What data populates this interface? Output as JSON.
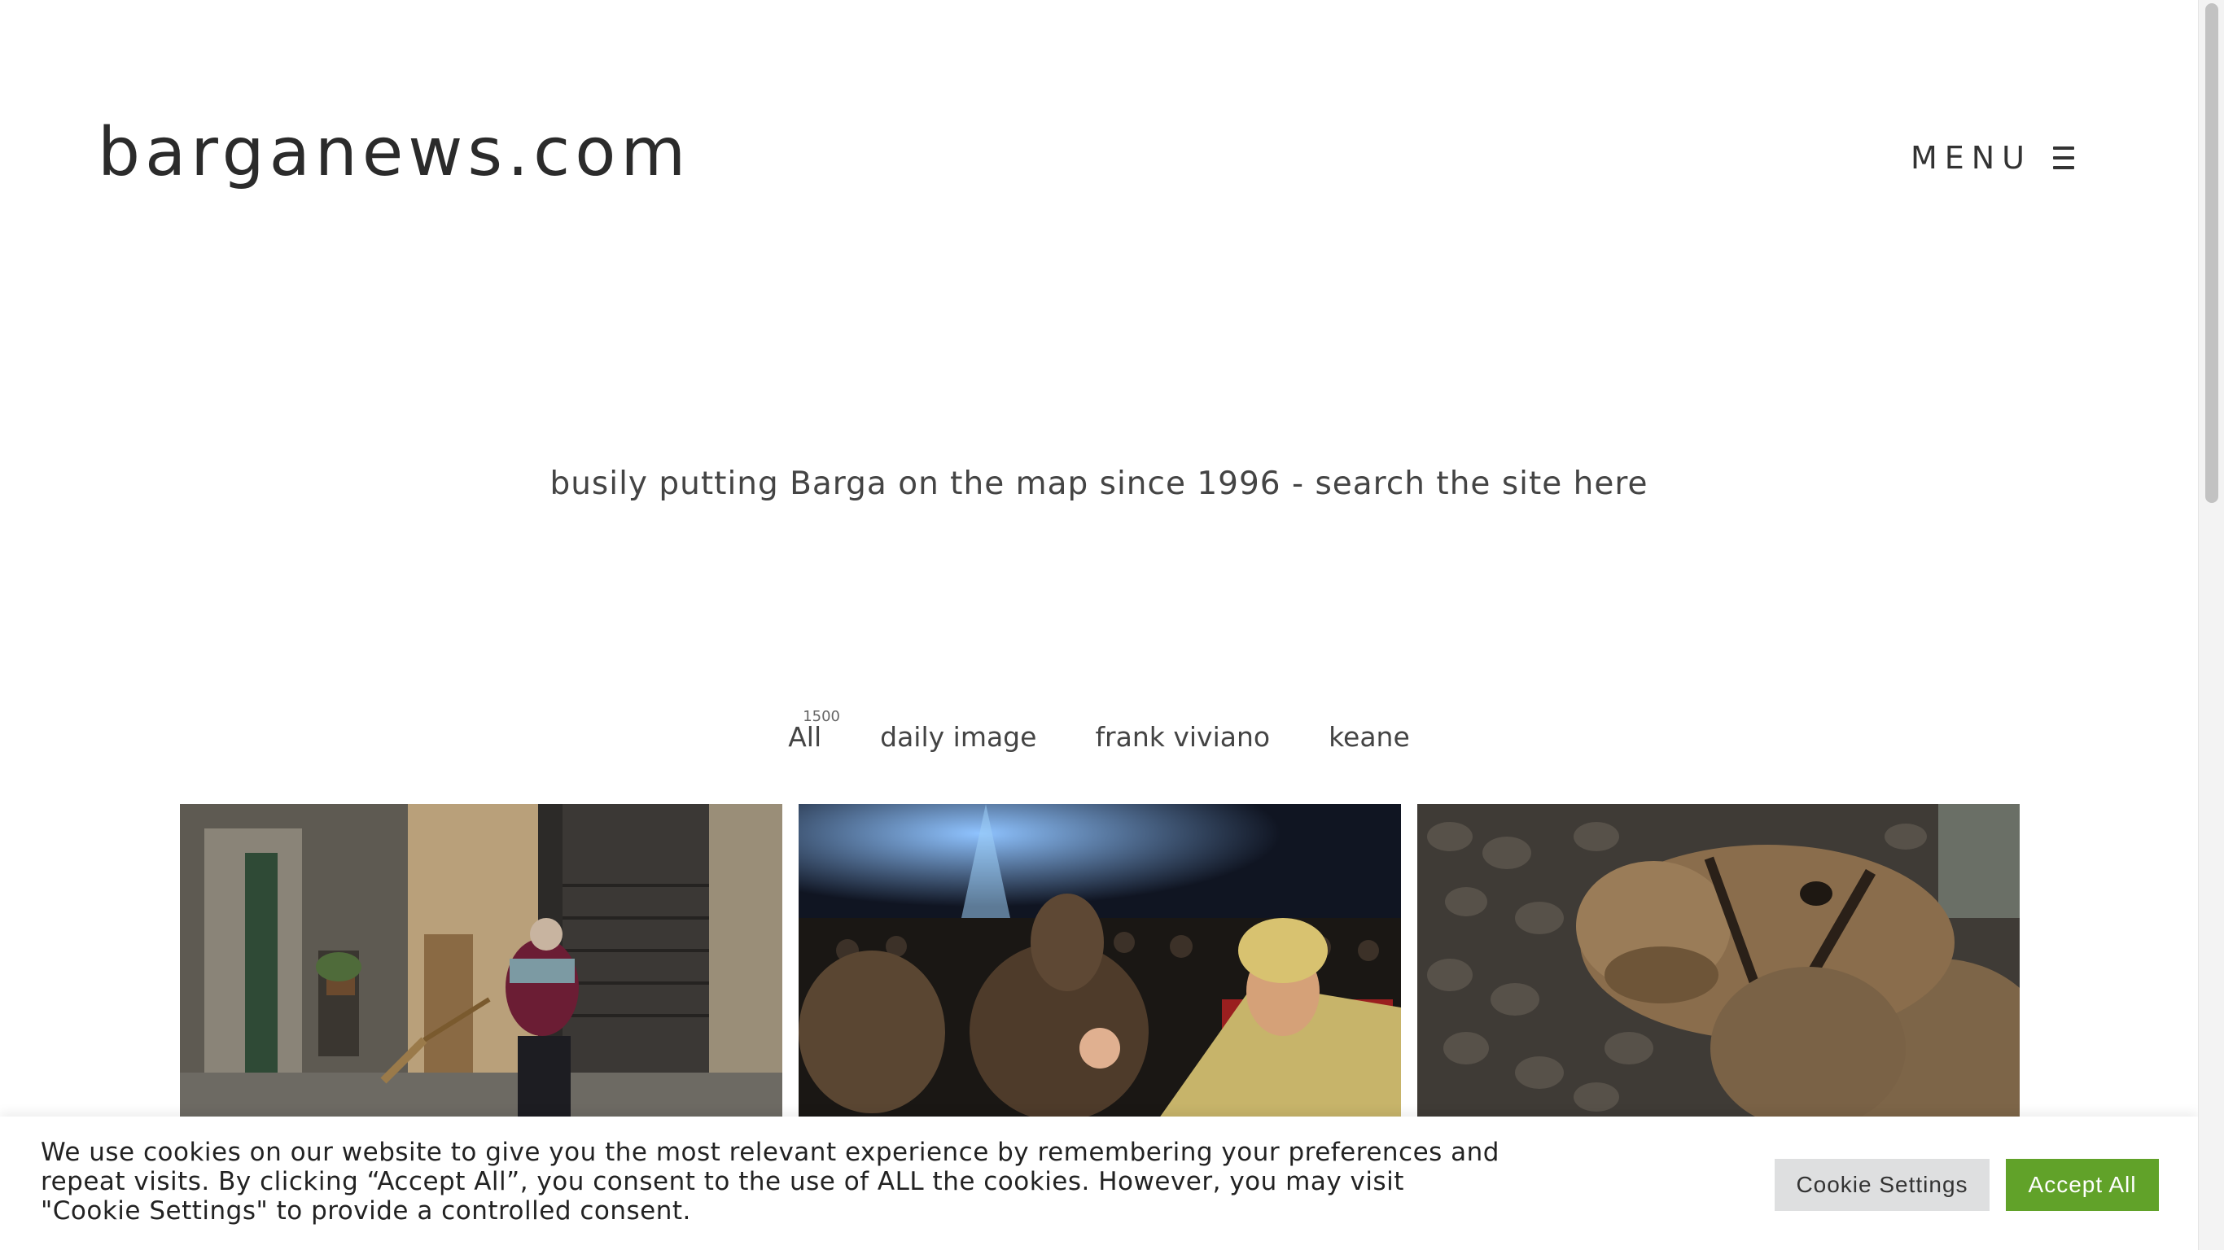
{
  "header": {
    "logo": "barganews.com",
    "menu_label": "MENU",
    "menu_icon": "hamburger-icon"
  },
  "tagline": {
    "text": "busily putting Barga on the map since 1996 - ",
    "search_link": "search the site here"
  },
  "filters": [
    {
      "label": "All",
      "count": "1500"
    },
    {
      "label": "daily image"
    },
    {
      "label": "frank viviano"
    },
    {
      "label": "keane"
    }
  ],
  "gallery": [
    {
      "subject": "street-sweeper-alley-photo"
    },
    {
      "subject": "camels-night-procession-photo"
    },
    {
      "subject": "camel-closeup-stone-wall-photo"
    }
  ],
  "cookie": {
    "text": "We use cookies on our website to give you the most relevant experience by remembering your preferences and repeat visits. By clicking “Accept All”, you consent to the use of ALL the cookies. However, you may visit \"Cookie Settings\" to provide a controlled consent.",
    "settings_label": "Cookie Settings",
    "accept_label": "Accept All",
    "accept_color": "#61a229",
    "settings_color": "#dedfe0"
  }
}
